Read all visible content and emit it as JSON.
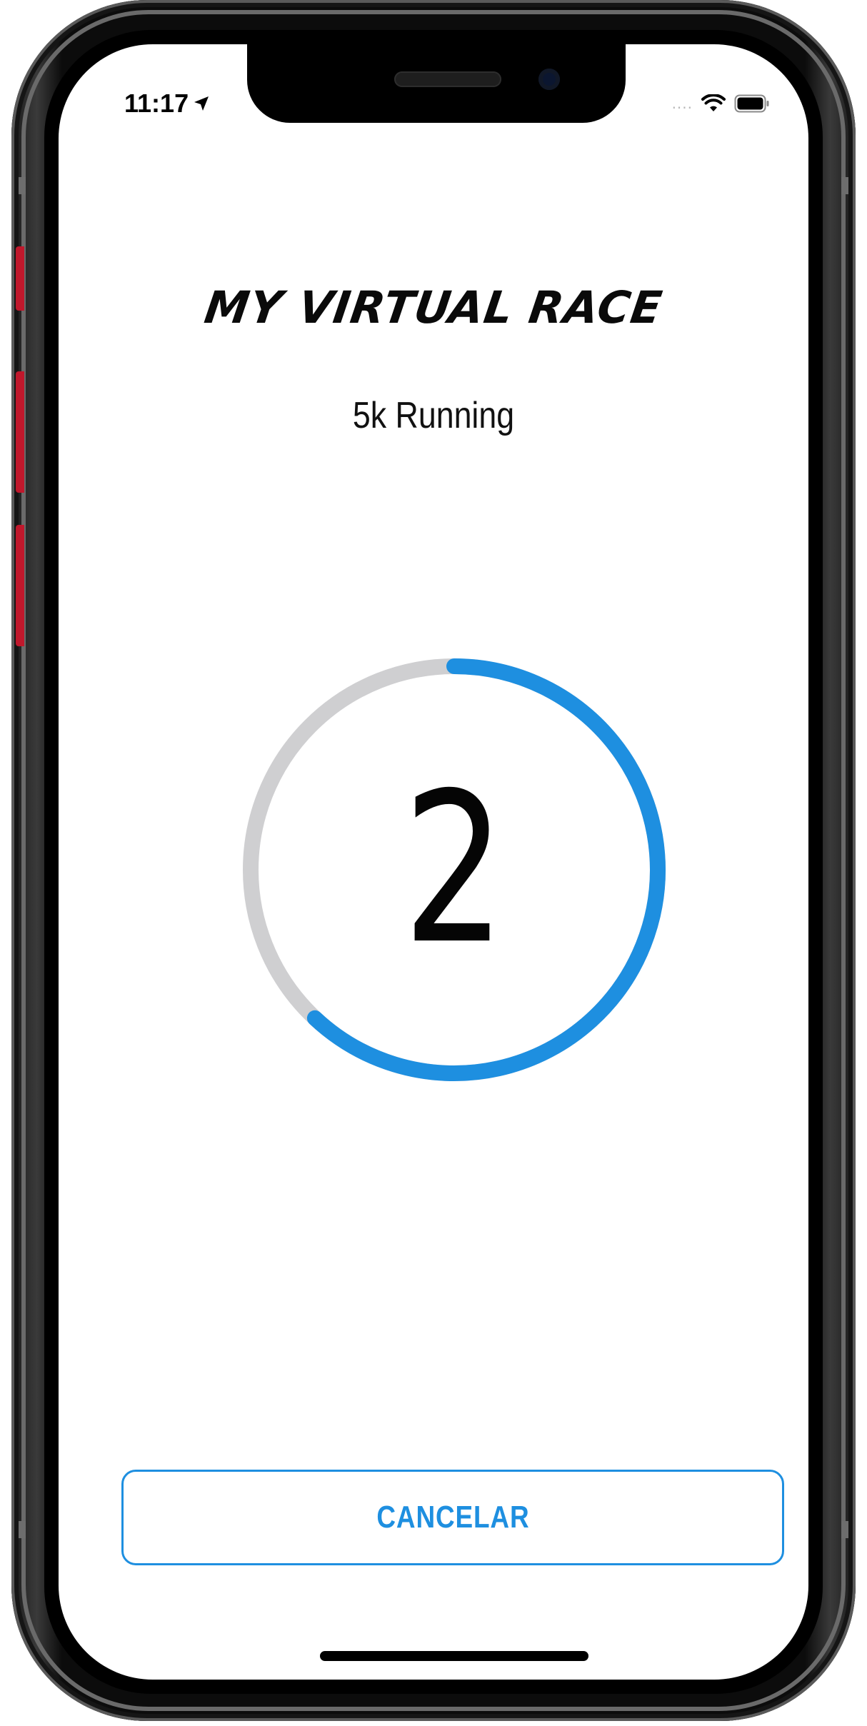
{
  "status_bar": {
    "time": "11:17",
    "location_icon": "location-arrow-icon",
    "signal_icon": "signal-dots-icon",
    "signal_text": "....",
    "wifi_icon": "wifi-icon",
    "battery_icon": "battery-icon"
  },
  "header": {
    "title": "MY VIRTUAL RACE",
    "subtitle": "5k Running"
  },
  "countdown": {
    "value": "2",
    "progress_fraction": 0.62,
    "progress_color": "#1e8fe0",
    "track_color": "#cfcfd1"
  },
  "actions": {
    "cancel_label": "CANCELAR"
  },
  "colors": {
    "accent": "#1e8fe0",
    "text": "#0a0a0a",
    "device_button": "#c0182c"
  }
}
